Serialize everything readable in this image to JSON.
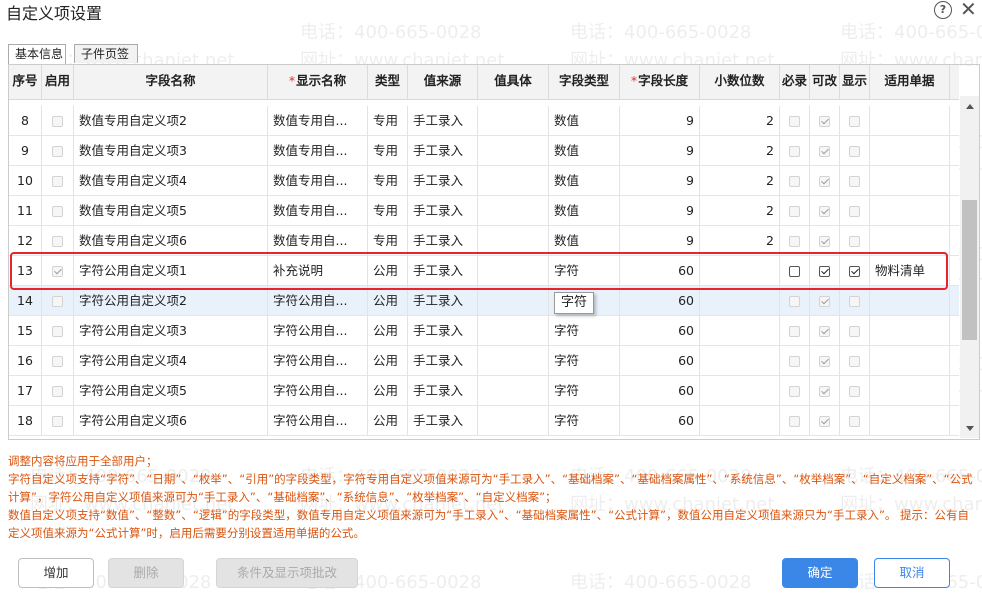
{
  "dialog": {
    "title": "自定义项设置",
    "help_icon": "?",
    "close_icon": "✕"
  },
  "tabs": [
    {
      "label": "基本信息",
      "active": true
    },
    {
      "label": "子件页签",
      "active": false
    }
  ],
  "columns": [
    {
      "key": "seq",
      "label": "序号",
      "required": false
    },
    {
      "key": "enabled",
      "label": "启用",
      "required": false
    },
    {
      "key": "field_name",
      "label": "字段名称",
      "required": false
    },
    {
      "key": "display_name",
      "label": "显示名称",
      "required": true
    },
    {
      "key": "type",
      "label": "类型",
      "required": false
    },
    {
      "key": "value_source",
      "label": "值来源",
      "required": false
    },
    {
      "key": "value_detail",
      "label": "值具体",
      "required": false
    },
    {
      "key": "field_type",
      "label": "字段类型",
      "required": false
    },
    {
      "key": "field_length",
      "label": "字段长度",
      "required": true
    },
    {
      "key": "decimals",
      "label": "小数位数",
      "required": false
    },
    {
      "key": "mandatory",
      "label": "必录",
      "required": false
    },
    {
      "key": "editable",
      "label": "可改",
      "required": false
    },
    {
      "key": "visible",
      "label": "显示",
      "required": false
    },
    {
      "key": "applicable_docs",
      "label": "适用单据",
      "required": false
    }
  ],
  "rows": [
    {
      "seq": "8",
      "enabled": false,
      "field_name": "数值专用自定义项2",
      "display_name": "数值专用自...",
      "type": "专用",
      "value_source": "手工录入",
      "value_detail": "",
      "field_type": "数值",
      "field_length": "9",
      "decimals": "2",
      "mandatory": false,
      "editable": true,
      "visible": false,
      "applicable_docs": ""
    },
    {
      "seq": "9",
      "enabled": false,
      "field_name": "数值专用自定义项3",
      "display_name": "数值专用自...",
      "type": "专用",
      "value_source": "手工录入",
      "value_detail": "",
      "field_type": "数值",
      "field_length": "9",
      "decimals": "2",
      "mandatory": false,
      "editable": true,
      "visible": false,
      "applicable_docs": ""
    },
    {
      "seq": "10",
      "enabled": false,
      "field_name": "数值专用自定义项4",
      "display_name": "数值专用自...",
      "type": "专用",
      "value_source": "手工录入",
      "value_detail": "",
      "field_type": "数值",
      "field_length": "9",
      "decimals": "2",
      "mandatory": false,
      "editable": true,
      "visible": false,
      "applicable_docs": ""
    },
    {
      "seq": "11",
      "enabled": false,
      "field_name": "数值专用自定义项5",
      "display_name": "数值专用自...",
      "type": "专用",
      "value_source": "手工录入",
      "value_detail": "",
      "field_type": "数值",
      "field_length": "9",
      "decimals": "2",
      "mandatory": false,
      "editable": true,
      "visible": false,
      "applicable_docs": ""
    },
    {
      "seq": "12",
      "enabled": false,
      "field_name": "数值专用自定义项6",
      "display_name": "数值专用自...",
      "type": "专用",
      "value_source": "手工录入",
      "value_detail": "",
      "field_type": "数值",
      "field_length": "9",
      "decimals": "2",
      "mandatory": false,
      "editable": true,
      "visible": false,
      "applicable_docs": ""
    },
    {
      "seq": "13",
      "enabled": true,
      "field_name": "字符公用自定义项1",
      "display_name": "补充说明",
      "type": "公用",
      "value_source": "手工录入",
      "value_detail": "",
      "field_type": "字符",
      "field_length": "60",
      "decimals": "",
      "mandatory": false,
      "editable": true,
      "visible": true,
      "applicable_docs": "物料清单",
      "highlighted": true
    },
    {
      "seq": "14",
      "enabled": false,
      "field_name": "字符公用自定义项2",
      "display_name": "字符公用自...",
      "type": "公用",
      "value_source": "手工录入",
      "value_detail": "",
      "field_type": "",
      "field_length": "60",
      "decimals": "",
      "mandatory": false,
      "editable": true,
      "visible": false,
      "applicable_docs": "",
      "selected": true
    },
    {
      "seq": "15",
      "enabled": false,
      "field_name": "字符公用自定义项3",
      "display_name": "字符公用自...",
      "type": "公用",
      "value_source": "手工录入",
      "value_detail": "",
      "field_type": "字符",
      "field_length": "60",
      "decimals": "",
      "mandatory": false,
      "editable": true,
      "visible": false,
      "applicable_docs": ""
    },
    {
      "seq": "16",
      "enabled": false,
      "field_name": "字符公用自定义项4",
      "display_name": "字符公用自...",
      "type": "公用",
      "value_source": "手工录入",
      "value_detail": "",
      "field_type": "字符",
      "field_length": "60",
      "decimals": "",
      "mandatory": false,
      "editable": true,
      "visible": false,
      "applicable_docs": ""
    },
    {
      "seq": "17",
      "enabled": false,
      "field_name": "字符公用自定义项5",
      "display_name": "字符公用自...",
      "type": "公用",
      "value_source": "手工录入",
      "value_detail": "",
      "field_type": "字符",
      "field_length": "60",
      "decimals": "",
      "mandatory": false,
      "editable": true,
      "visible": false,
      "applicable_docs": ""
    },
    {
      "seq": "18",
      "enabled": false,
      "field_name": "字符公用自定义项6",
      "display_name": "字符公用自...",
      "type": "公用",
      "value_source": "手工录入",
      "value_detail": "",
      "field_type": "字符",
      "field_length": "60",
      "decimals": "",
      "mandatory": false,
      "editable": true,
      "visible": false,
      "applicable_docs": ""
    }
  ],
  "tooltip": "字符",
  "notes": [
    "调整内容将应用于全部用户；",
    "字符自定义项支持“字符”、“日期”、“枚举”、“引用”的字段类型，字符专用自定义项值来源可为“手工录入”、“基础档案”、“基础档案属性”、“系统信息”、“枚举档案”、“自定义档案”、“公式计算”，字符公用自定义项值来源可为“手工录入”、“基础档案”、“系统信息”、“枚举档案”、“自定义档案”；",
    "数值自定义项支持“数值”、“整数”、“逻辑”的字段类型，数值专用自定义项值来源可为“手工录入”、“基础档案属性”、“公式计算”，数值公用自定义项值来源只为“手工录入”。 提示：公有自定义项值来源为“公式计算”时，启用后需要分别设置适用单据的公式。"
  ],
  "buttons": {
    "add": "增加",
    "delete": "删除",
    "conditions": "条件及显示项批改",
    "ok": "确定",
    "cancel": "取消"
  },
  "watermark": {
    "phone": "电话：400-665-0028",
    "site": "网址：www.chanjet.net"
  },
  "colors": {
    "accent": "#3a87e8",
    "highlight_border": "#e8232b",
    "notes_text": "#d9540e",
    "required_star": "#e0302b"
  }
}
